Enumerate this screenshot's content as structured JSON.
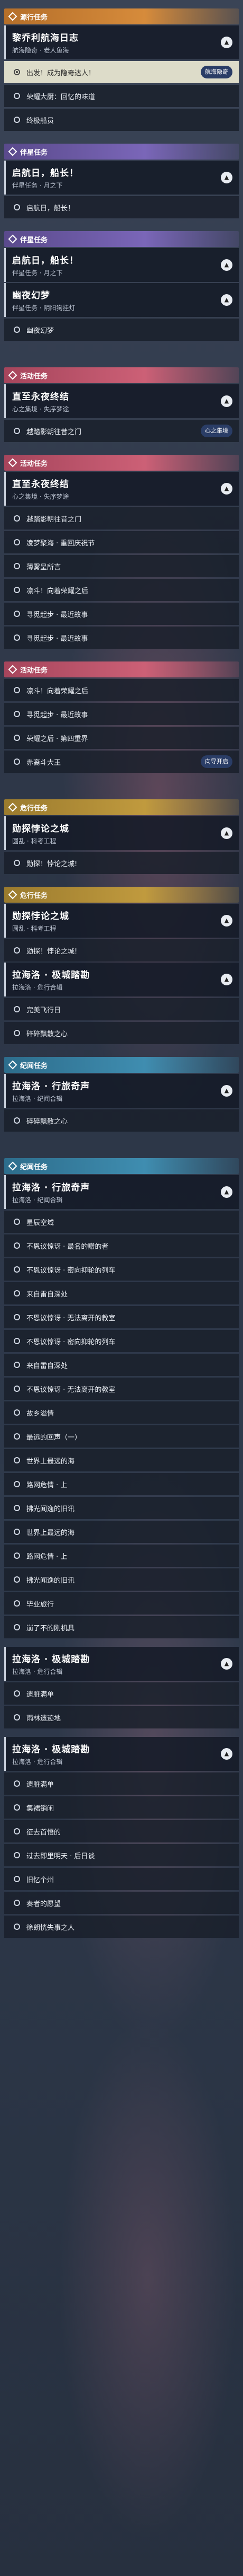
{
  "groups": [
    {
      "cat": "源行任务",
      "color": "orange",
      "head": {
        "t": "黎乔利航海日志",
        "s": "航海隐奇 · 老人鱼海"
      },
      "rows": [
        {
          "l": "出发！成为隐奇达人！",
          "active": true,
          "badge": "航海隐奇"
        },
        {
          "l": "荣耀大厨：回忆的味道"
        },
        {
          "l": "终极船员"
        }
      ]
    },
    {
      "cat": "伴星任务",
      "color": "purple",
      "head": {
        "t": "启航日，船长！",
        "s": "伴星任务 · 月之下"
      },
      "rows": [
        {
          "l": "启航日，船长！"
        }
      ]
    },
    {
      "cat": "伴星任务",
      "color": "purple",
      "head": {
        "t": "启航日，船长！",
        "s": "伴星任务 · 月之下"
      },
      "rows": [],
      "extraHead": {
        "t": "幽夜幻梦",
        "s": "伴星任务 · 阴阳狗挂灯"
      },
      "extraRows": [
        {
          "l": "幽夜幻梦"
        }
      ]
    },
    {
      "cat": "活动任务",
      "color": "pink",
      "head": {
        "t": "直至永夜终结",
        "s": "心之集境 · 失序梦途"
      },
      "rows": [
        {
          "l": "越踏影朝往昔之门",
          "badge": "心之集境"
        }
      ]
    },
    {
      "cat": "活动任务",
      "color": "pink",
      "head": {
        "t": "直至永夜终结",
        "s": "心之集境 · 失序梦途"
      },
      "rows": [
        {
          "l": "越踏影朝往昔之门"
        },
        {
          "l": "凌梦聚海 · 重回庆祝节"
        },
        {
          "l": "薄雾呈所言"
        },
        {
          "l": "凛斗！向着荣耀之后"
        },
        {
          "l": "寻觅起步 · 最近故事"
        },
        {
          "l": "寻觅起步 · 最近故事"
        }
      ]
    },
    {
      "cat": "活动任务",
      "color": "pink",
      "head": null,
      "rows": [
        {
          "l": "凛斗！向着荣耀之后"
        },
        {
          "l": "寻觅起步 · 最近故事"
        },
        {
          "l": "荣耀之后 · 第四重界"
        },
        {
          "l": "赤裔斗大王",
          "badge": "向导开启"
        }
      ]
    },
    {
      "cat": "危行任务",
      "color": "gold",
      "head": {
        "t": "勋探悖论之城",
        "s": "圆乱 · 科考工程"
      },
      "rows": [
        {
          "l": "勋探！悖论之城!"
        }
      ]
    },
    {
      "cat": "危行任务",
      "color": "gold",
      "head": {
        "t": "勋探悖论之城",
        "s": "圆乱 · 科考工程"
      },
      "rows": [
        {
          "l": "勋探！悖论之城!"
        }
      ],
      "extraHead": {
        "t": "拉海洛 · 极城踏勘",
        "s": "拉海洛 · 危行合辑"
      },
      "extraRows": [
        {
          "l": "完美飞行日"
        },
        {
          "l": "碎碎飘散之心"
        }
      ]
    },
    {
      "cat": "纪闻任务",
      "color": "teal",
      "head": {
        "t": "拉海洛 · 行旅奇声",
        "s": "拉海洛 · 纪闻合辑"
      },
      "rows": [
        {
          "l": "碎碎飘散之心"
        }
      ]
    },
    {
      "cat": "纪闻任务",
      "color": "teal",
      "head": {
        "t": "拉海洛 · 行旅奇声",
        "s": "拉海洛 · 纪闻合辑"
      },
      "rows": [
        {
          "l": "星辰空域"
        },
        {
          "l": "不恩议惊讶 · 最名的赠的者"
        },
        {
          "l": "不恩议惊讶 · 密向抑轮的列车"
        },
        {
          "l": "来自雷自深处"
        },
        {
          "l": "不恩议惊讶 · 无法离开的教室"
        },
        {
          "l": "不恩议惊讶 · 密向抑轮的列车"
        },
        {
          "l": "来自雷自深处"
        },
        {
          "l": "不恩议惊讶 · 无法离开的教室"
        },
        {
          "l": "故乡溢情"
        },
        {
          "l": "最远的回声（一）"
        },
        {
          "l": "世界上最远的海"
        },
        {
          "l": "路网危情 · 上"
        },
        {
          "l": "拂光闻逸的旧讯"
        },
        {
          "l": "世界上最远的海"
        },
        {
          "l": "路网危情 · 上"
        },
        {
          "l": "拂光闻逸的旧讯"
        },
        {
          "l": "毕业旅行"
        },
        {
          "l": "崩了不的刚机具"
        }
      ]
    },
    {
      "cat": null,
      "color": null,
      "head": {
        "t": "拉海洛 · 极城踏勘",
        "s": "拉海洛 · 危行合辑"
      },
      "rows": [
        {
          "l": "遗脏满单"
        },
        {
          "l": "雨林遗迹地"
        }
      ]
    },
    {
      "cat": null,
      "color": null,
      "head": {
        "t": "拉海洛 · 极城踏勘",
        "s": "拉海洛 · 危行合辑"
      },
      "rows": [
        {
          "l": "遗脏满单"
        },
        {
          "l": "集裙销闲"
        },
        {
          "l": "征去首悟的"
        },
        {
          "l": "过去即里明天 · 后日谈"
        },
        {
          "l": "旧忆个州"
        },
        {
          "l": "奏者的愿望"
        },
        {
          "l": "徐朗恍失事之人"
        }
      ]
    }
  ]
}
